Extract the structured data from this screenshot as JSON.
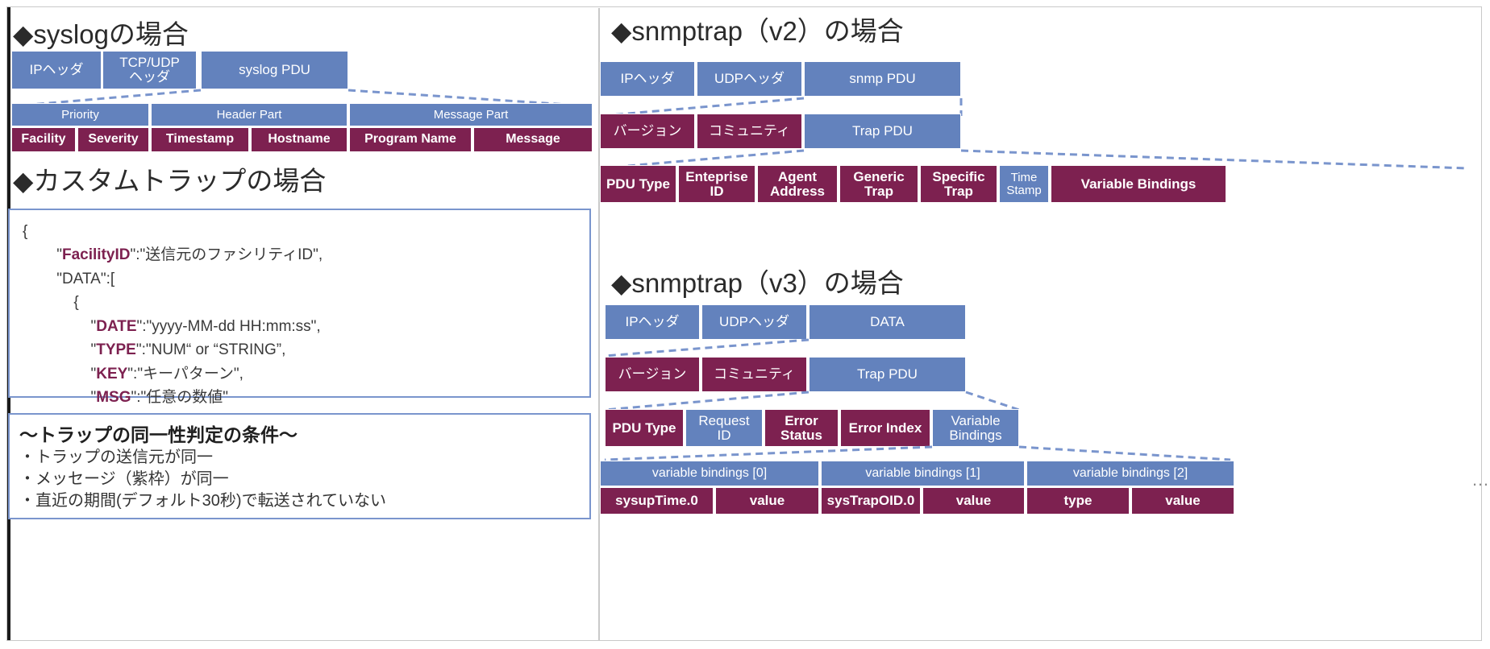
{
  "colors": {
    "blue": "#6382bd",
    "purple": "#7d2150",
    "panel_border": "#7a95cd",
    "connector": "#7a95cd"
  },
  "sections": {
    "syslog": {
      "heading": "◆syslogの場合",
      "layer1": [
        "IPヘッダ",
        "TCP/UDP\nヘッダ",
        "syslog PDU"
      ],
      "layer2": [
        "Priority",
        "Header Part",
        "Message Part"
      ],
      "layer3": [
        "Facility",
        "Severity",
        "Timestamp",
        "Hostname",
        "Program Name",
        "Message"
      ]
    },
    "custom_trap": {
      "heading": "◆カスタムトラップの場合",
      "code_lines": [
        "{",
        "        \"FacilityID\":\"送信元のファシリティID\",",
        "        \"DATA\":[",
        "            {",
        "                \"DATE\":\"yyyy-MM-dd HH:mm:ss\",",
        "                \"TYPE\":\"NUM“ or “STRING”,",
        "                \"KEY\":\"キーパターン\",",
        "                \"MSG\":\"任意の数値\"",
        "            }",
        "        ]",
        "}"
      ],
      "code_keys": [
        "FacilityID",
        "DATE",
        "TYPE",
        "KEY",
        "MSG"
      ]
    },
    "conditions": {
      "title": "～トラップの同一性判定の条件～",
      "lines": [
        "・トラップの送信元が同一",
        "・メッセージ（紫枠）が同一",
        "・直近の期間(デフォルト30秒)で転送されていない"
      ]
    },
    "snmptrap_v2": {
      "heading": "◆snmptrap（v2）の場合",
      "layer1": [
        "IPヘッダ",
        "UDPヘッダ",
        "snmp PDU"
      ],
      "layer2": [
        "バージョン",
        "コミュニティ",
        "Trap PDU"
      ],
      "layer3": [
        "PDU Type",
        "Enteprise\nID",
        "Agent\nAddress",
        "Generic\nTrap",
        "Specific\nTrap",
        "Time\nStamp",
        "Variable Bindings"
      ]
    },
    "snmptrap_v3": {
      "heading": "◆snmptrap（v3）の場合",
      "layer1": [
        "IPヘッダ",
        "UDPヘッダ",
        "DATA"
      ],
      "layer2": [
        "バージョン",
        "コミュニティ",
        "Trap PDU"
      ],
      "layer3": [
        "PDU Type",
        "Request\nID",
        "Error\nStatus",
        "Error Index",
        "Variable\nBindings"
      ],
      "bindings_header": [
        "variable bindings [0]",
        "variable bindings [1]",
        "variable bindings [2]"
      ],
      "bindings_cells": [
        "sysupTime.0",
        "value",
        "sysTrapOID.0",
        "value",
        "type",
        "value"
      ],
      "overflow_ellipsis": "…"
    }
  }
}
